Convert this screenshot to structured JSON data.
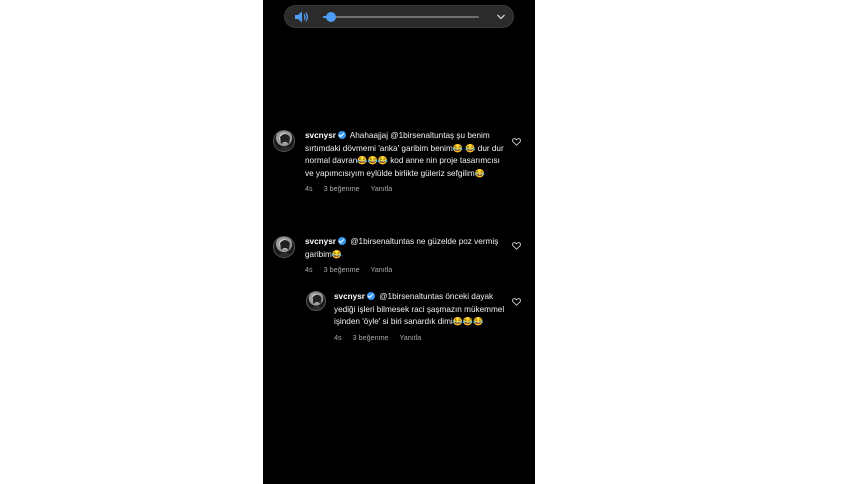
{
  "volume": {
    "level": 0.05,
    "icon": "speaker-icon",
    "expand_icon": "chevron-down-icon",
    "accent": "#4f9cf5"
  },
  "comments": [
    {
      "username": "svcnysr",
      "text": "Ahahaajjaj @1birsenaltuntaş şu benim sırtımdaki dövmemi 'anka' garibim benim😂 😂 dur dur normal davran😂😂😂 kod anne nin proje tasarımcısı ve yapımcısıyım eylülde birlikte güleriz sefgilim😂",
      "age": "4s",
      "likes": "3 beğenme",
      "reply": "Yanıtla"
    },
    {
      "username": "svcnysr",
      "text": "@1birsenaltuntas  ne güzelde poz vermiş garibim😂",
      "age": "4s",
      "likes": "3 beğenme",
      "reply": "Yanıtla"
    },
    {
      "username": "svcnysr",
      "text": "@1birsenaltuntas  önceki dayak yediği işleri bilmesek raci şaşmazın mükemmel işinden 'öyle' si biri sanardık dimi😂😂😂",
      "age": "4s",
      "likes": "3 beğenme",
      "reply": "Yanıtla"
    }
  ],
  "colors": {
    "background": "#000000",
    "verified": "#3897f0",
    "meta": "#a8a8a8"
  }
}
